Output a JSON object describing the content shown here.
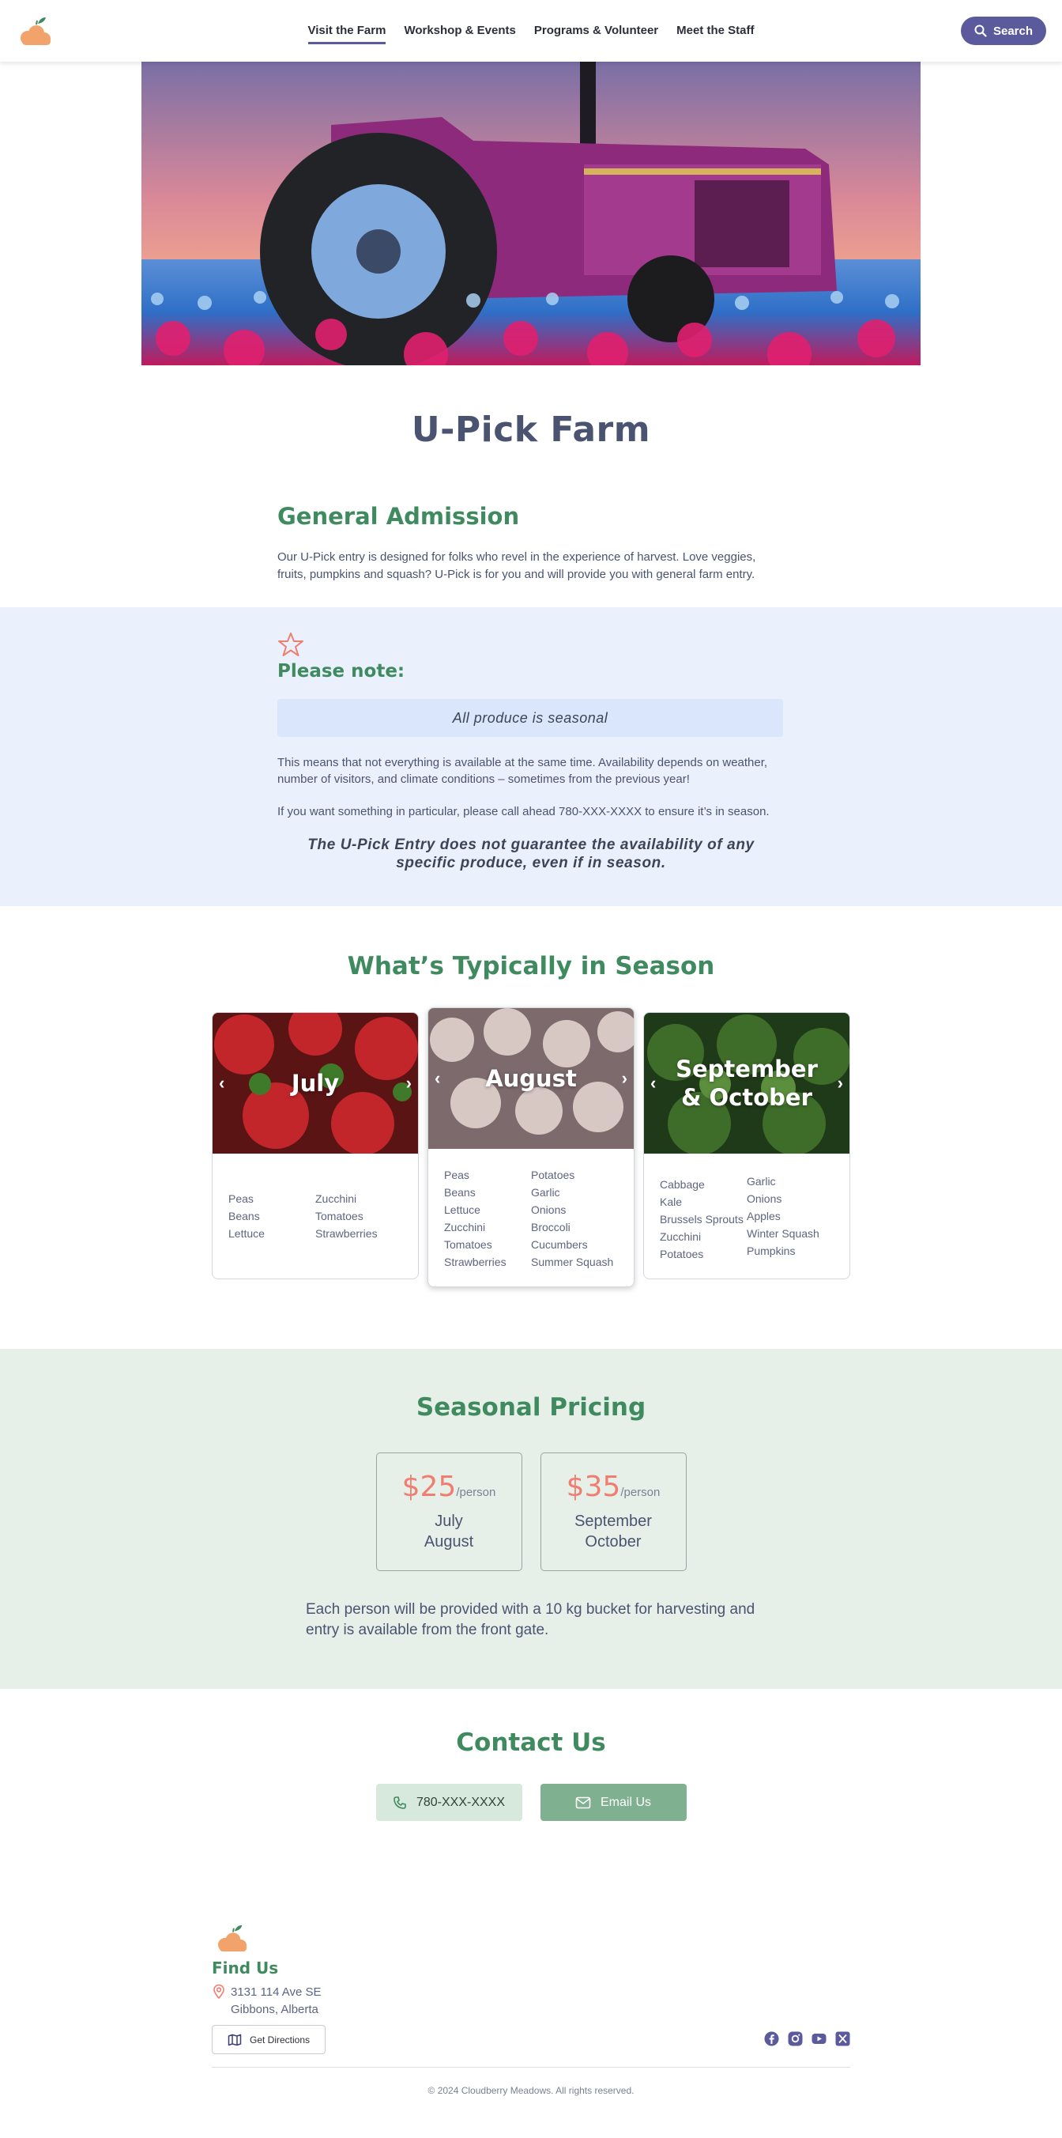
{
  "nav": {
    "items": [
      "Visit the Farm",
      "Workshop & Events",
      "Programs & Volunteer",
      "Meet the Staff"
    ],
    "active_index": 0,
    "search_label": "Search"
  },
  "page": {
    "title": "U-Pick Farm"
  },
  "general": {
    "title": "General Admission",
    "text": "Our U-Pick entry is designed for folks who revel in the experience of harvest. Love veggies, fruits, pumpkins and squash? U-Pick is for you and will provide you with general farm entry."
  },
  "note": {
    "title": "Please note:",
    "highlight": "All produce is seasonal",
    "p1": "This means that not everything is available at the same time. Availability depends on weather, number of visitors, and climate conditions – sometimes from the previous year!",
    "p2": "If you want something in particular, please call ahead 780-XXX-XXXX to ensure it’s in season.",
    "disclaimer": "The U-Pick Entry does not guarantee the availability of any specific produce, even if in season."
  },
  "season": {
    "title": "What’s Typically in Season",
    "cards": [
      {
        "label": "July",
        "col1": [
          "Peas",
          "Beans",
          "Lettuce"
        ],
        "col2": [
          "Zucchini",
          "Tomatoes",
          "Strawberries"
        ]
      },
      {
        "label": "August",
        "col1": [
          "Peas",
          "Beans",
          "Lettuce",
          "Zucchini",
          "Tomatoes",
          "Strawberries"
        ],
        "col2": [
          "Potatoes",
          "Garlic",
          "Onions",
          "Broccoli",
          "Cucumbers",
          "Summer Squash"
        ]
      },
      {
        "label": "September & October",
        "col1": [
          "Cabbage",
          "Kale",
          "Brussels Sprouts",
          "Zucchini",
          "Potatoes"
        ],
        "col2": [
          "Garlic",
          "Onions",
          "Apples",
          "Winter Squash",
          "Pumpkins"
        ]
      }
    ]
  },
  "pricing": {
    "title": "Seasonal Pricing",
    "per_label": "/person",
    "plans": [
      {
        "price": "$25",
        "month1": "July",
        "month2": "August"
      },
      {
        "price": "$35",
        "month1": "September",
        "month2": "October"
      }
    ],
    "note": "Each person will be provided with a 10 kg bucket for harvesting and entry is available from the front gate."
  },
  "contact": {
    "title": "Contact Us",
    "phone": "780-XXX-XXXX",
    "email_label": "Email Us"
  },
  "footer": {
    "find_title": "Find Us",
    "address_line1": "3131 114 Ave SE",
    "address_line2": "Gibbons, Alberta",
    "directions_label": "Get Directions",
    "copyright": "© 2024 Cloudberry Meadows. All rights reserved."
  },
  "colors": {
    "brand_purple": "#5b5a9c",
    "heading_green": "#3f8a5f",
    "price_coral": "#f07d6f",
    "note_band": "#eaf0fc",
    "pricing_band": "#e7efe9"
  },
  "icons": [
    "cloudberry-logo-icon",
    "search-icon",
    "star-icon",
    "chevron-left-icon",
    "chevron-right-icon",
    "phone-icon",
    "mail-icon",
    "map-pin-icon",
    "map-icon",
    "facebook-icon",
    "instagram-icon",
    "youtube-icon",
    "x-icon"
  ]
}
